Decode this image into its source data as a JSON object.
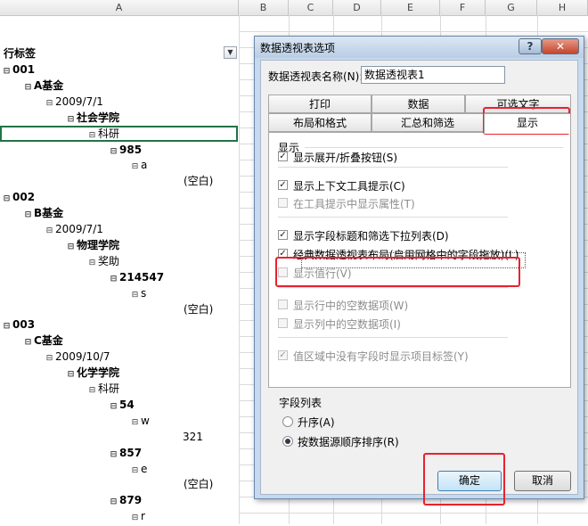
{
  "sheet": {
    "columns": [
      {
        "label": "A",
        "width": 268,
        "selected": true
      },
      {
        "label": "B",
        "width": 56
      },
      {
        "label": "C",
        "width": 50
      },
      {
        "label": "D",
        "width": 54
      },
      {
        "label": "E",
        "width": 66
      },
      {
        "label": "F",
        "width": 51
      },
      {
        "label": "G",
        "width": 58
      },
      {
        "label": "H",
        "width": 57
      }
    ],
    "pivot_header": "行标签",
    "rows": [
      {
        "text": "001",
        "level": 0,
        "bold": true,
        "toggle": "⊟"
      },
      {
        "text": "A基金",
        "level": 1,
        "bold": true,
        "toggle": "⊟"
      },
      {
        "text": "2009/7/1",
        "level": 2,
        "bold": false,
        "toggle": "⊟"
      },
      {
        "text": "社会学院",
        "level": 3,
        "bold": true,
        "toggle": "⊟"
      },
      {
        "text": "科研",
        "level": 4,
        "bold": false,
        "toggle": "⊟"
      },
      {
        "text": "985",
        "level": 5,
        "bold": true,
        "toggle": "⊟"
      },
      {
        "text": "a",
        "level": 6,
        "bold": false,
        "toggle": "⊟"
      },
      {
        "text": "(空白)",
        "level": 7,
        "bold": false,
        "toggle": ""
      },
      {
        "text": "002",
        "level": 0,
        "bold": true,
        "toggle": "⊟"
      },
      {
        "text": "B基金",
        "level": 1,
        "bold": true,
        "toggle": "⊟"
      },
      {
        "text": "2009/7/1",
        "level": 2,
        "bold": false,
        "toggle": "⊟"
      },
      {
        "text": "物理学院",
        "level": 3,
        "bold": true,
        "toggle": "⊟"
      },
      {
        "text": "奖助",
        "level": 4,
        "bold": false,
        "toggle": "⊟"
      },
      {
        "text": "214547",
        "level": 5,
        "bold": true,
        "toggle": "⊟"
      },
      {
        "text": "s",
        "level": 6,
        "bold": false,
        "toggle": "⊟"
      },
      {
        "text": "(空白)",
        "level": 7,
        "bold": false,
        "toggle": ""
      },
      {
        "text": "003",
        "level": 0,
        "bold": true,
        "toggle": "⊟"
      },
      {
        "text": "C基金",
        "level": 1,
        "bold": true,
        "toggle": "⊟"
      },
      {
        "text": "2009/10/7",
        "level": 2,
        "bold": false,
        "toggle": "⊟"
      },
      {
        "text": "化学学院",
        "level": 3,
        "bold": true,
        "toggle": "⊟"
      },
      {
        "text": "科研",
        "level": 4,
        "bold": false,
        "toggle": "⊟"
      },
      {
        "text": "54",
        "level": 5,
        "bold": true,
        "toggle": "⊟"
      },
      {
        "text": "w",
        "level": 6,
        "bold": false,
        "toggle": "⊟"
      },
      {
        "text": "321",
        "level": 7,
        "bold": false,
        "toggle": ""
      },
      {
        "text": "857",
        "level": 5,
        "bold": true,
        "toggle": "⊟"
      },
      {
        "text": "e",
        "level": 6,
        "bold": false,
        "toggle": "⊟"
      },
      {
        "text": "(空白)",
        "level": 7,
        "bold": false,
        "toggle": ""
      },
      {
        "text": "879",
        "level": 5,
        "bold": true,
        "toggle": "⊟"
      },
      {
        "text": "r",
        "level": 6,
        "bold": false,
        "toggle": "⊟"
      }
    ],
    "selected_row": 4
  },
  "dialog": {
    "title": "数据透视表选项",
    "help_label": "?",
    "close_label": "✕",
    "name_label": "数据透视表名称(N):",
    "name_value": "数据透视表1",
    "tabs_row1": [
      "打印",
      "数据",
      "可选文字"
    ],
    "tabs_row2": [
      "布局和格式",
      "汇总和筛选",
      "显示"
    ],
    "active_tab": "显示",
    "display_section": "显示",
    "options": [
      {
        "label": "显示展开/折叠按钮(S)",
        "checked": true,
        "enabled": true
      },
      {
        "label": "显示上下文工具提示(C)",
        "checked": true,
        "enabled": true
      },
      {
        "label": "在工具提示中显示属性(T)",
        "checked": false,
        "enabled": false
      },
      {
        "label": "显示字段标题和筛选下拉列表(D)",
        "checked": true,
        "enabled": true
      },
      {
        "label": "经典数据透视表布局(启用网格中的字段拖放)(L)",
        "checked": true,
        "enabled": true
      },
      {
        "label": "显示值行(V)",
        "checked": false,
        "enabled": false
      },
      {
        "label": "显示行中的空数据项(W)",
        "checked": false,
        "enabled": false
      },
      {
        "label": "显示列中的空数据项(I)",
        "checked": false,
        "enabled": false
      },
      {
        "label": "值区域中没有字段时显示项目标签(Y)",
        "checked": true,
        "enabled": false
      }
    ],
    "field_list_section": "字段列表",
    "sort_options": [
      {
        "label": "升序(A)",
        "selected": false
      },
      {
        "label": "按数据源顺序排序(R)",
        "selected": true
      }
    ],
    "ok_label": "确定",
    "cancel_label": "取消"
  },
  "colors": {
    "highlight": "#e8222e",
    "selection_border": "#217346",
    "dialog_frame": "#c6d9ee"
  }
}
